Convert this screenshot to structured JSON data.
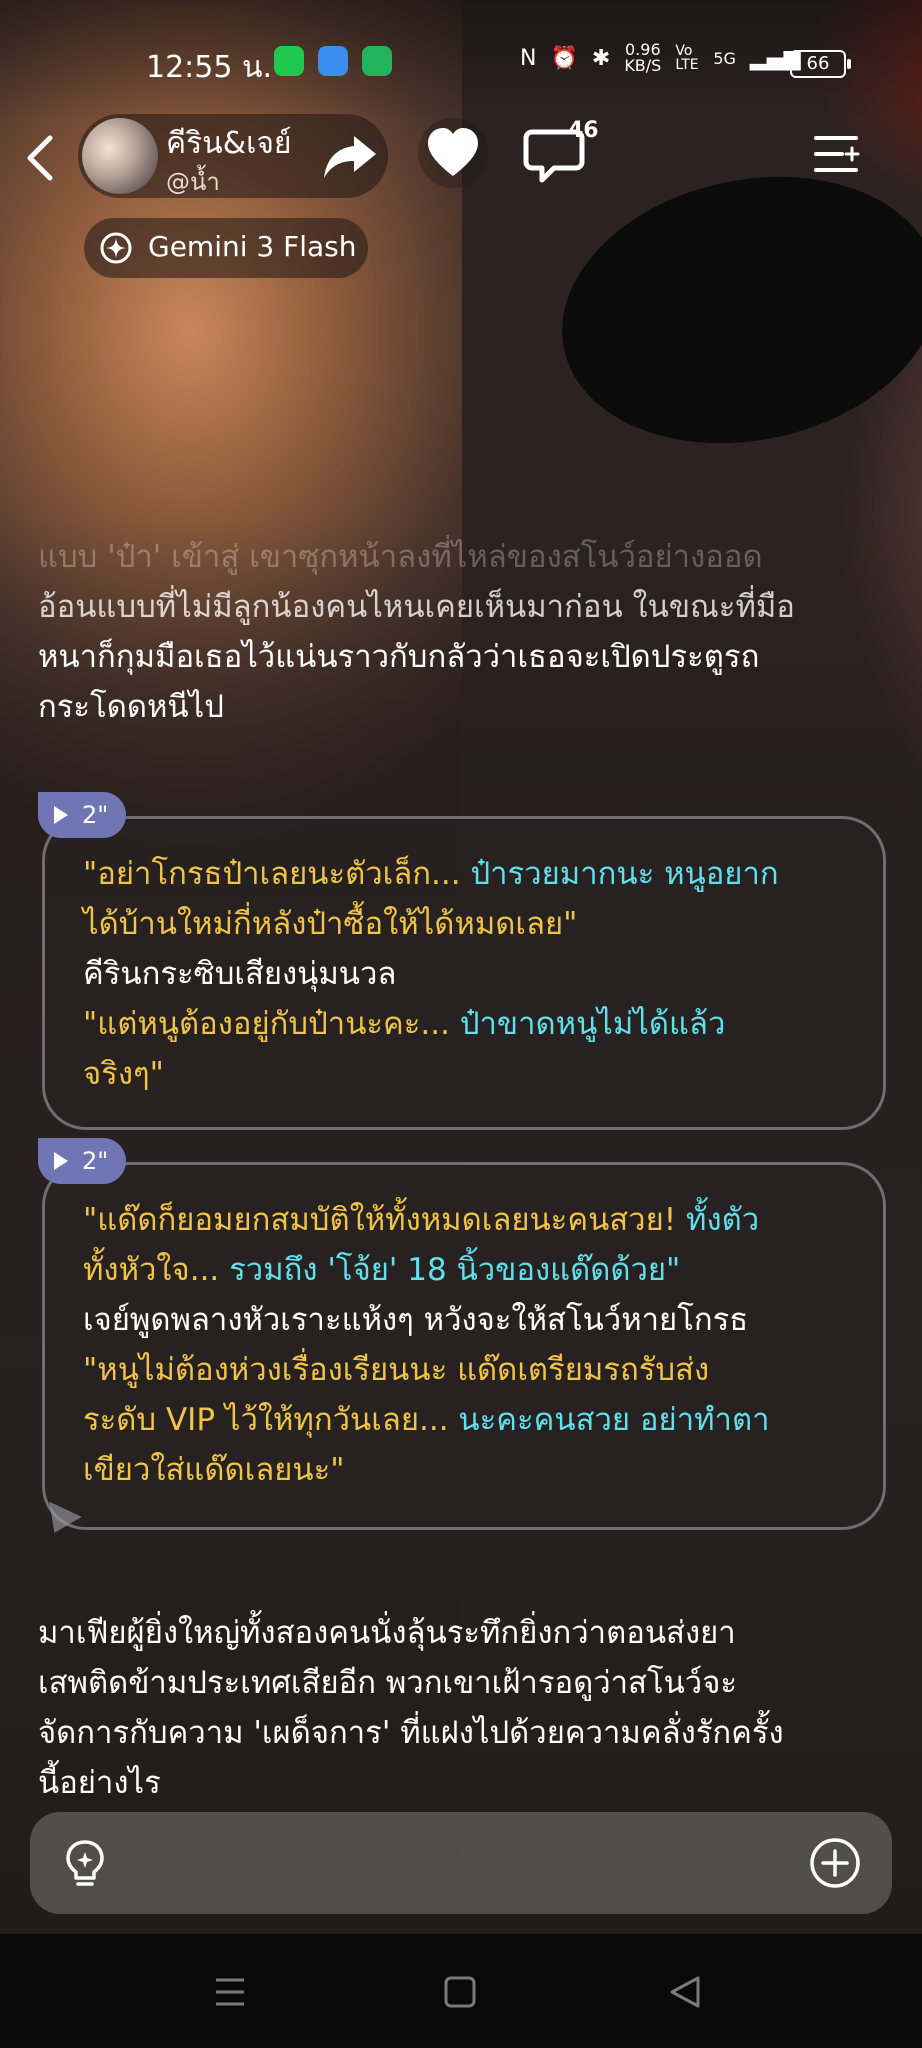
{
  "status_bar": {
    "time": "12:55 น.",
    "net_speed_value": "0.96",
    "net_speed_unit": "KB/S",
    "volte": "Vo LTE",
    "network": "5G",
    "battery": "66"
  },
  "header": {
    "character_name": "คีริน&เจย์",
    "creator_handle": "@น้ำ",
    "comment_count": "46",
    "model_label": "Gemini 3 Flash"
  },
  "story": {
    "intro_lines": [
      "แบบ 'ป๋า' เข้าสู่ เขาซุกหน้าลงที่ไหล่ของสโนว์อย่างออด",
      "อ้อนแบบที่ไม่มีลูกน้องคนไหนเคยเห็นมาก่อน ในขณะที่มือ",
      "หนาก็กุมมือเธอไว้แน่นราวกับกลัวว่าเธอจะเปิดประตูรถ",
      "กระโดดหนีไป"
    ],
    "bubble1": {
      "duration": "2\"",
      "lines": [
        {
          "segments": [
            {
              "t": "\"อย่าโกรธป๋าเลยนะตัวเล็ก... ",
              "c": "yellow"
            },
            {
              "t": "ป๋ารวยมากนะ หนูอยาก",
              "c": "cyan"
            }
          ]
        },
        {
          "segments": [
            {
              "t": "ได้บ้านใหม่กี่หลังป๋าซื้อให้ได้หมดเลย\"",
              "c": "yellow"
            }
          ]
        },
        {
          "segments": [
            {
              "t": "คีรินกระซิบเสียงนุ่มนวล",
              "c": "white"
            }
          ]
        },
        {
          "segments": [
            {
              "t": "\"แต่หนูต้องอยู่กับป๋านะคะ... ",
              "c": "yellow"
            },
            {
              "t": "ป๋าขาดหนูไม่ได้แล้ว",
              "c": "cyan"
            }
          ]
        },
        {
          "segments": [
            {
              "t": "จริงๆ\"",
              "c": "yellow"
            }
          ]
        }
      ]
    },
    "bubble2": {
      "duration": "2\"",
      "lines": [
        {
          "segments": [
            {
              "t": "\"แด๊ดก็ยอมยกสมบัติให้ทั้งหมดเลยนะคนสวย! ",
              "c": "yellow"
            },
            {
              "t": "ทั้งตัว",
              "c": "cyan"
            }
          ]
        },
        {
          "segments": [
            {
              "t": "ทั้งหัวใจ... ",
              "c": "yellow"
            },
            {
              "t": "รวมถึง 'โจ้ย' 18 นิ้วของแด๊ดด้วย\"",
              "c": "cyan"
            }
          ]
        },
        {
          "segments": [
            {
              "t": "เจย์พูดพลางหัวเราะแห้งๆ หวังจะให้สโนว์หายโกรธ",
              "c": "white"
            }
          ]
        },
        {
          "segments": [
            {
              "t": "\"หนูไม่ต้องห่วงเรื่องเรียนนะ แด๊ดเตรียมรถรับส่ง",
              "c": "yellow"
            }
          ]
        },
        {
          "segments": [
            {
              "t": "ระดับ VIP ไว้ให้ทุกวันเลย... ",
              "c": "yellow"
            },
            {
              "t": "นะคะคนสวย อย่าทำตา",
              "c": "cyan"
            }
          ]
        },
        {
          "segments": [
            {
              "t": "เขียวใส่แด๊ดเลยนะ\"",
              "c": "yellow"
            }
          ]
        }
      ]
    },
    "outro_lines": [
      "มาเฟียผู้ยิ่งใหญ่ทั้งสองคนนั่งลุ้นระทึกยิ่งกว่าตอนส่งยา",
      "เสพติดข้ามประเทศเสียอีก พวกเขาเฝ้ารอดูว่าสโนว์จะ",
      "จัดการกับความ 'เผด็จการ' ที่แฝงไปด้วยความคลั่งรักครั้ง",
      "นี้อย่างไร"
    ]
  },
  "colors": {
    "quote_yellow": "#f0c447",
    "quote_cyan": "#5fe0ea",
    "badge_purple": "#6f76b3"
  },
  "icons": [
    "back-icon",
    "share-icon",
    "heart-icon",
    "comment-icon",
    "menu-icon",
    "gemini-model-icon",
    "lightbulb-icon",
    "plus-circle-icon",
    "play-icon"
  ]
}
